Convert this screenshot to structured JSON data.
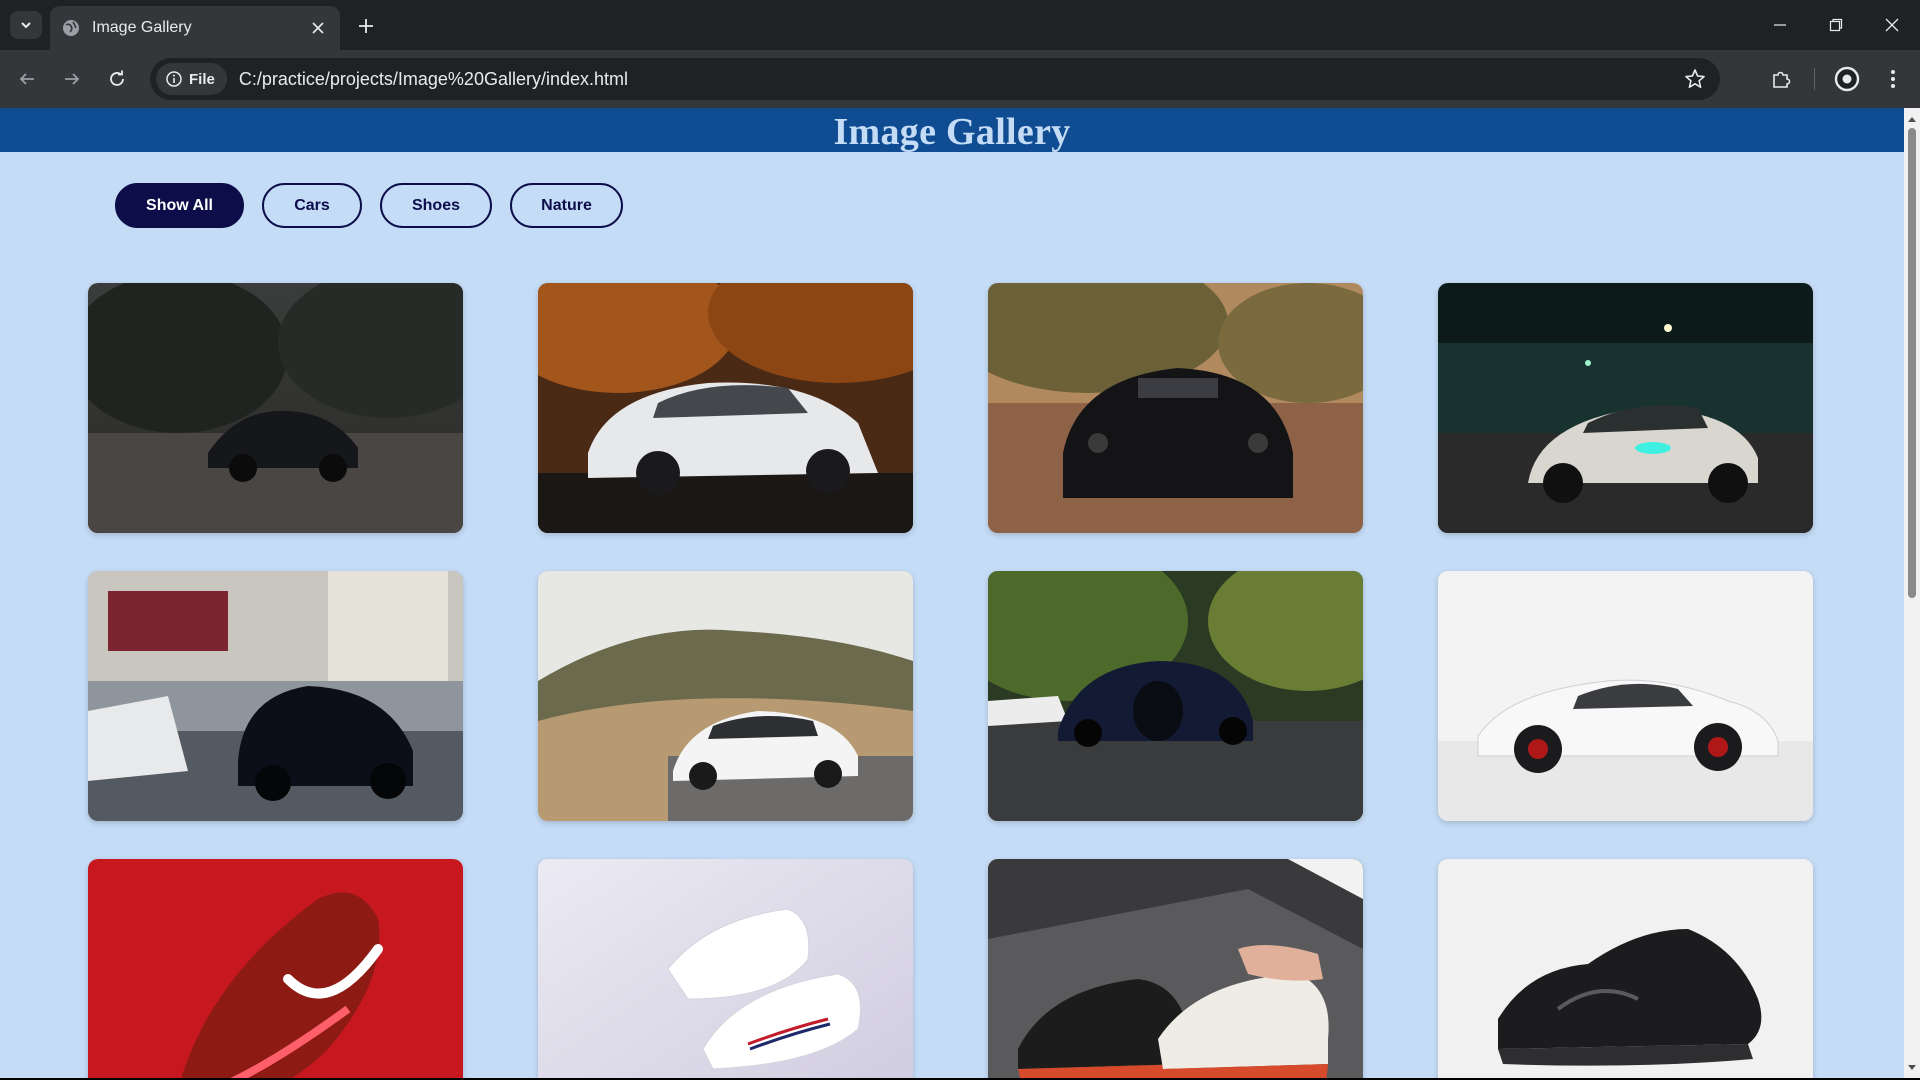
{
  "browser": {
    "tab": {
      "title": "Image Gallery"
    },
    "omnibox": {
      "chip_label": "File",
      "url": "C:/practice/projects/Image%20Gallery/index.html"
    }
  },
  "page": {
    "title": "Image Gallery",
    "filters": [
      {
        "label": "Show All",
        "active": true
      },
      {
        "label": "Cars",
        "active": false
      },
      {
        "label": "Shoes",
        "active": false
      },
      {
        "label": "Nature",
        "active": false
      }
    ],
    "gallery": [
      {
        "category": "cars",
        "subject": "dark sports car on leafy street"
      },
      {
        "category": "cars",
        "subject": "white sedan under autumn trees"
      },
      {
        "category": "cars",
        "subject": "black muscle car on brick road"
      },
      {
        "category": "cars",
        "subject": "white coupe at night"
      },
      {
        "category": "cars",
        "subject": "black luxury car on city street"
      },
      {
        "category": "cars",
        "subject": "white electric car by hills"
      },
      {
        "category": "cars",
        "subject": "dark blue hypercar on road"
      },
      {
        "category": "cars",
        "subject": "white sports car in studio"
      },
      {
        "category": "shoes",
        "subject": "red running shoe"
      },
      {
        "category": "shoes",
        "subject": "white sneakers"
      },
      {
        "category": "shoes",
        "subject": "sneakers being laced"
      },
      {
        "category": "shoes",
        "subject": "black running shoe"
      }
    ]
  },
  "colors": {
    "header_bg": "#0f4c91",
    "page_bg": "#c5dcf6",
    "button_dark": "#0d0d4a"
  }
}
